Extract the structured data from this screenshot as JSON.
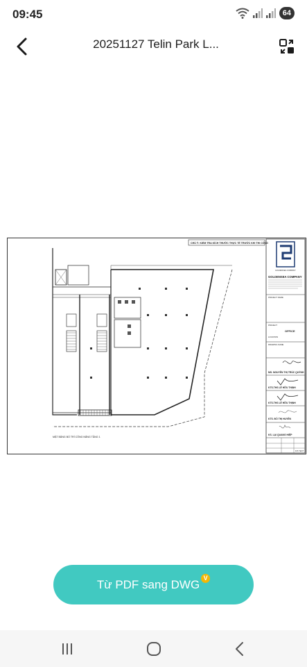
{
  "status_bar": {
    "time": "09:45",
    "battery": "64",
    "icons": [
      "wifi-icon",
      "signal-icon",
      "signal-icon",
      "battery-icon"
    ]
  },
  "app_bar": {
    "title": "20251127 Telin Park L...",
    "back_icon": "chevron-left-icon",
    "action_icon": "convert-icon"
  },
  "drawing": {
    "note": "CHÚ Ý: KIỂM TRA KÍCH THƯỚC THỰC TẾ TRƯỚC KHI THI CÔNG",
    "plan_label": "MẶT BẰNG BỐ TRÍ CÔNG NĂNG TẦNG 1",
    "company": "GOLDENSEA COMPANY",
    "logo_caption": "GOLDENSEA COMPANY",
    "project_label": "PROJECT NAME",
    "project_name_label": "PROJECT",
    "drawing_name": "OFFICE",
    "location_label": "LOCATION",
    "drawing_title_label": "DRAWING NAME",
    "signatures": [
      {
        "role": "MS. NGUYỄN THỊ TRÚC QUỲNH"
      },
      {
        "role": "KTS.THS LÊ HỮU THỊNH"
      },
      {
        "role": "KTS.THS LÊ HỮU THỊNH"
      },
      {
        "role": "KTS. ĐỖ THỊ HUYỀN"
      },
      {
        "role": "KS. LẠI QUANG HIỆP"
      }
    ],
    "sheet_no": "KIT-TEXT"
  },
  "convert_button": {
    "label": "Từ PDF sang DWG",
    "badge": "V",
    "color": "#41c9c1"
  },
  "nav_bar": {
    "icons": [
      "recent-apps-icon",
      "home-icon",
      "back-icon"
    ]
  }
}
